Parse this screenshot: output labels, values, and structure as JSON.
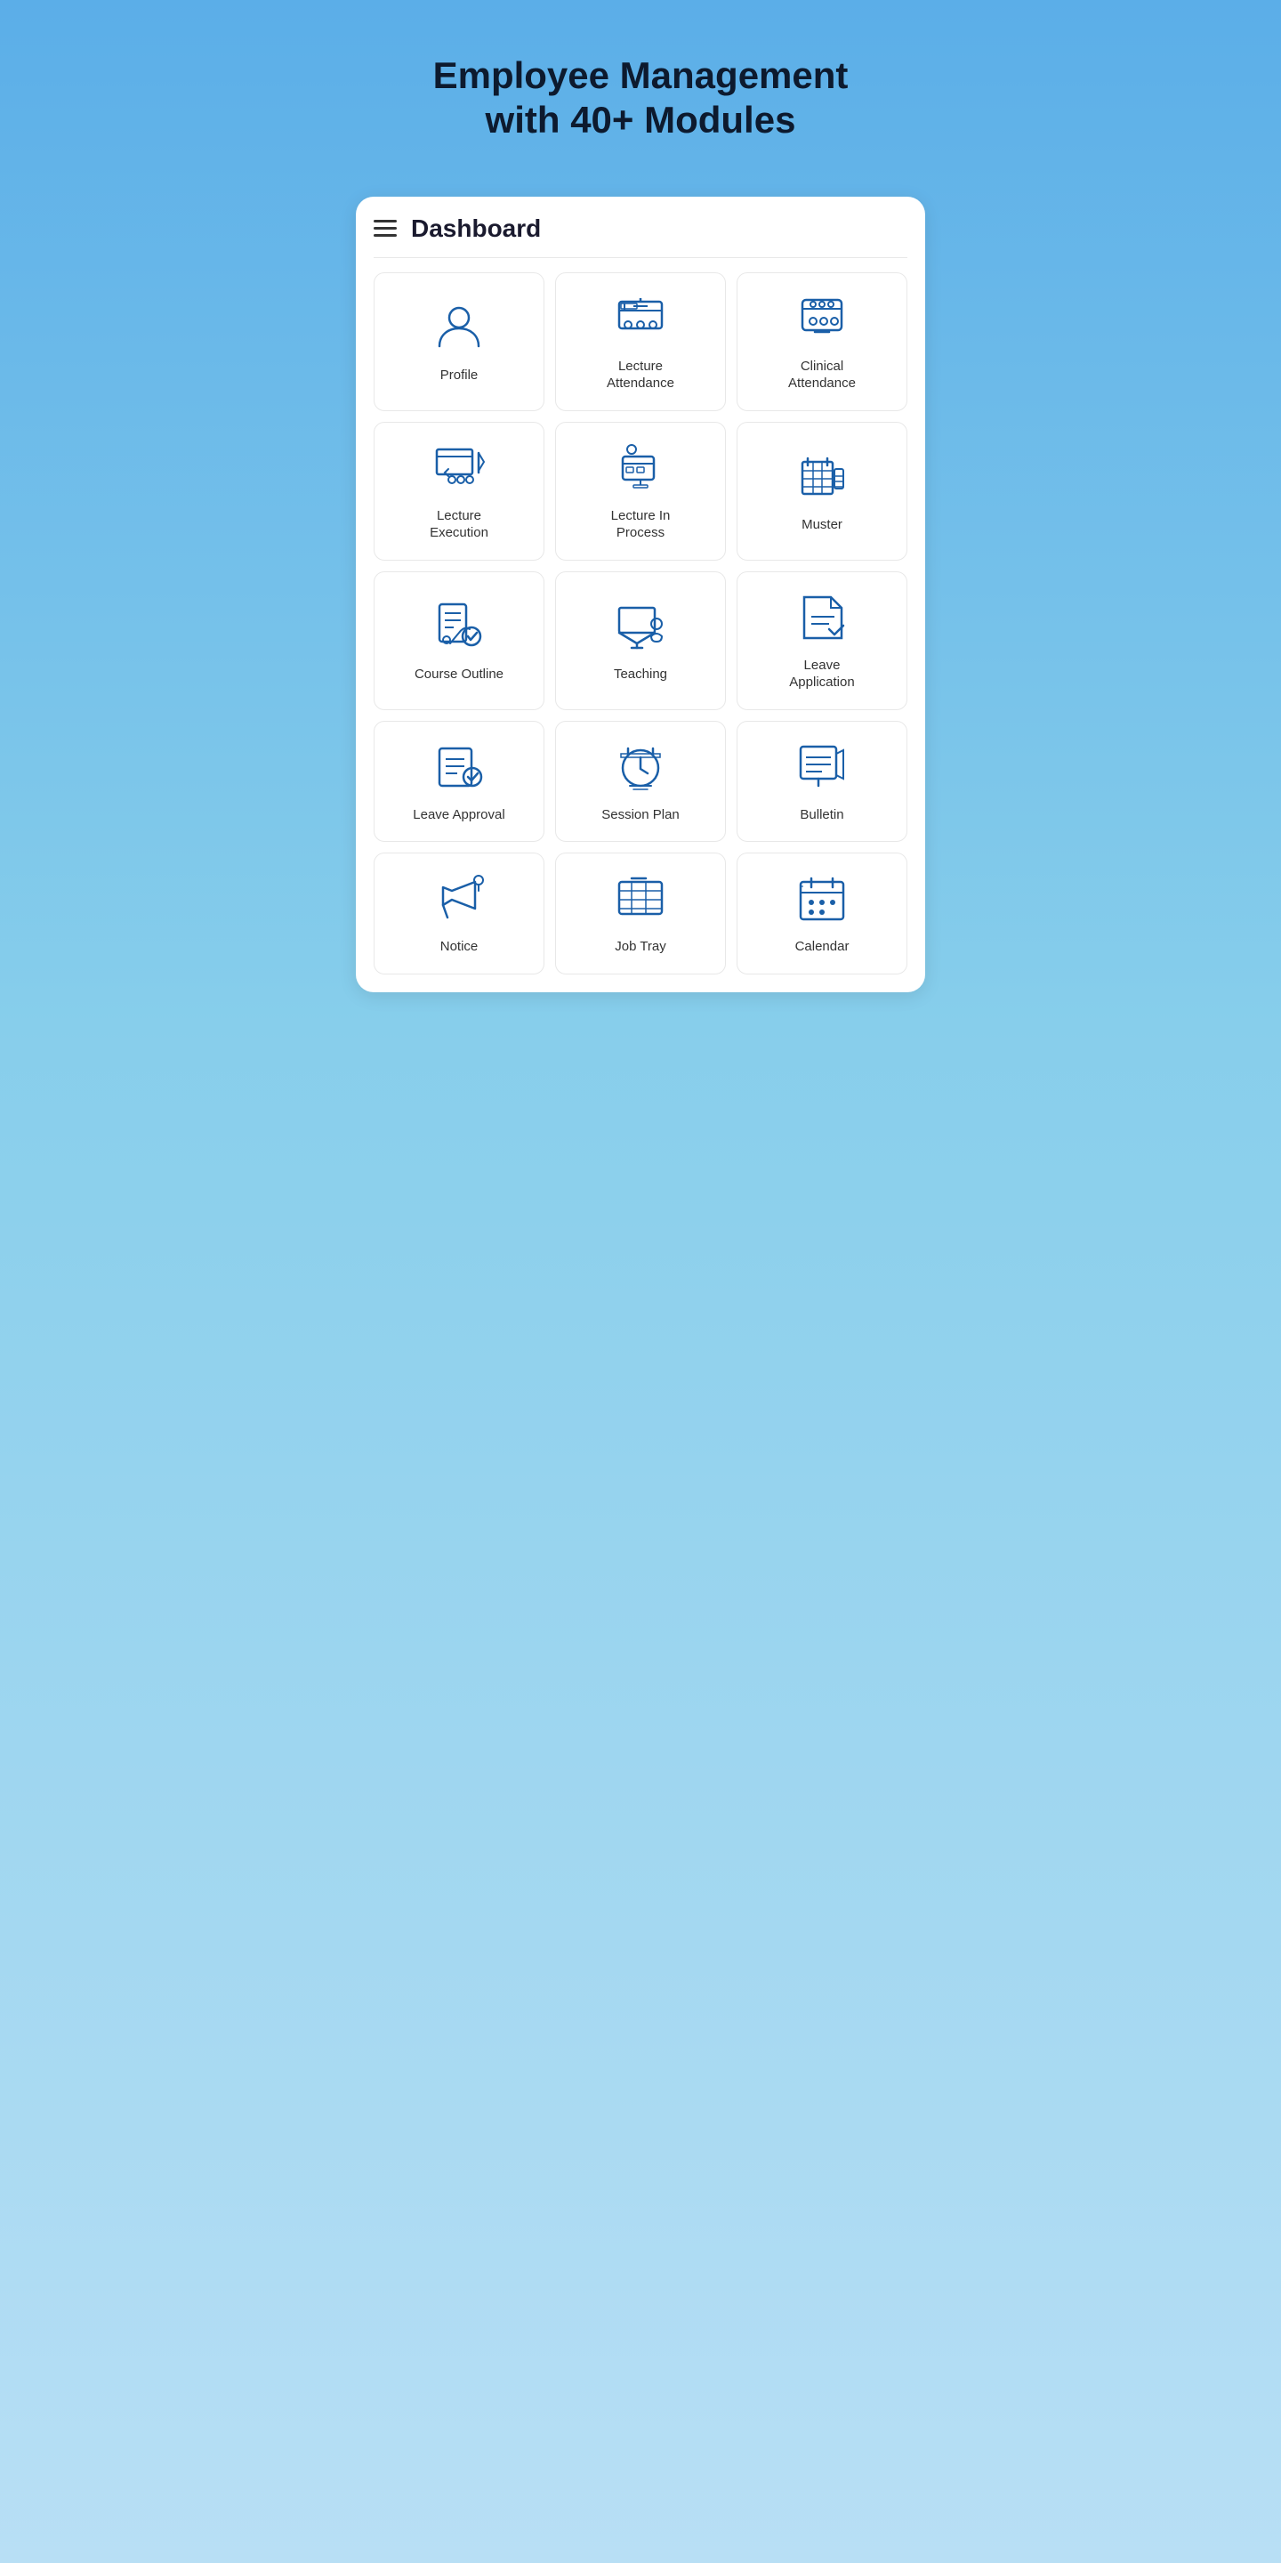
{
  "header": {
    "title": "Employee Management with 40+ Modules"
  },
  "dashboard": {
    "title": "Dashboard",
    "items": [
      {
        "id": "profile",
        "label": "Profile",
        "icon": "profile"
      },
      {
        "id": "lecture-attendance",
        "label": "Lecture\nAttendance",
        "icon": "lecture-attendance"
      },
      {
        "id": "clinical-attendance",
        "label": "Clinical\nAttendance",
        "icon": "clinical-attendance"
      },
      {
        "id": "lecture-execution",
        "label": "Lecture\nExecution",
        "icon": "lecture-execution"
      },
      {
        "id": "lecture-in-process",
        "label": "Lecture In\nProcess",
        "icon": "lecture-in-process"
      },
      {
        "id": "muster",
        "label": "Muster",
        "icon": "muster"
      },
      {
        "id": "course-outline",
        "label": "Course Outline",
        "icon": "course-outline"
      },
      {
        "id": "teaching",
        "label": "Teaching",
        "icon": "teaching"
      },
      {
        "id": "leave-application",
        "label": "Leave\nApplication",
        "icon": "leave-application"
      },
      {
        "id": "leave-approval",
        "label": "Leave Approval",
        "icon": "leave-approval"
      },
      {
        "id": "session-plan",
        "label": "Session Plan",
        "icon": "session-plan"
      },
      {
        "id": "bulletin",
        "label": "Bulletin",
        "icon": "bulletin"
      },
      {
        "id": "notice",
        "label": "Notice",
        "icon": "notice"
      },
      {
        "id": "job-tray",
        "label": "Job Tray",
        "icon": "job-tray"
      },
      {
        "id": "calendar",
        "label": "Calendar",
        "icon": "calendar"
      }
    ]
  }
}
